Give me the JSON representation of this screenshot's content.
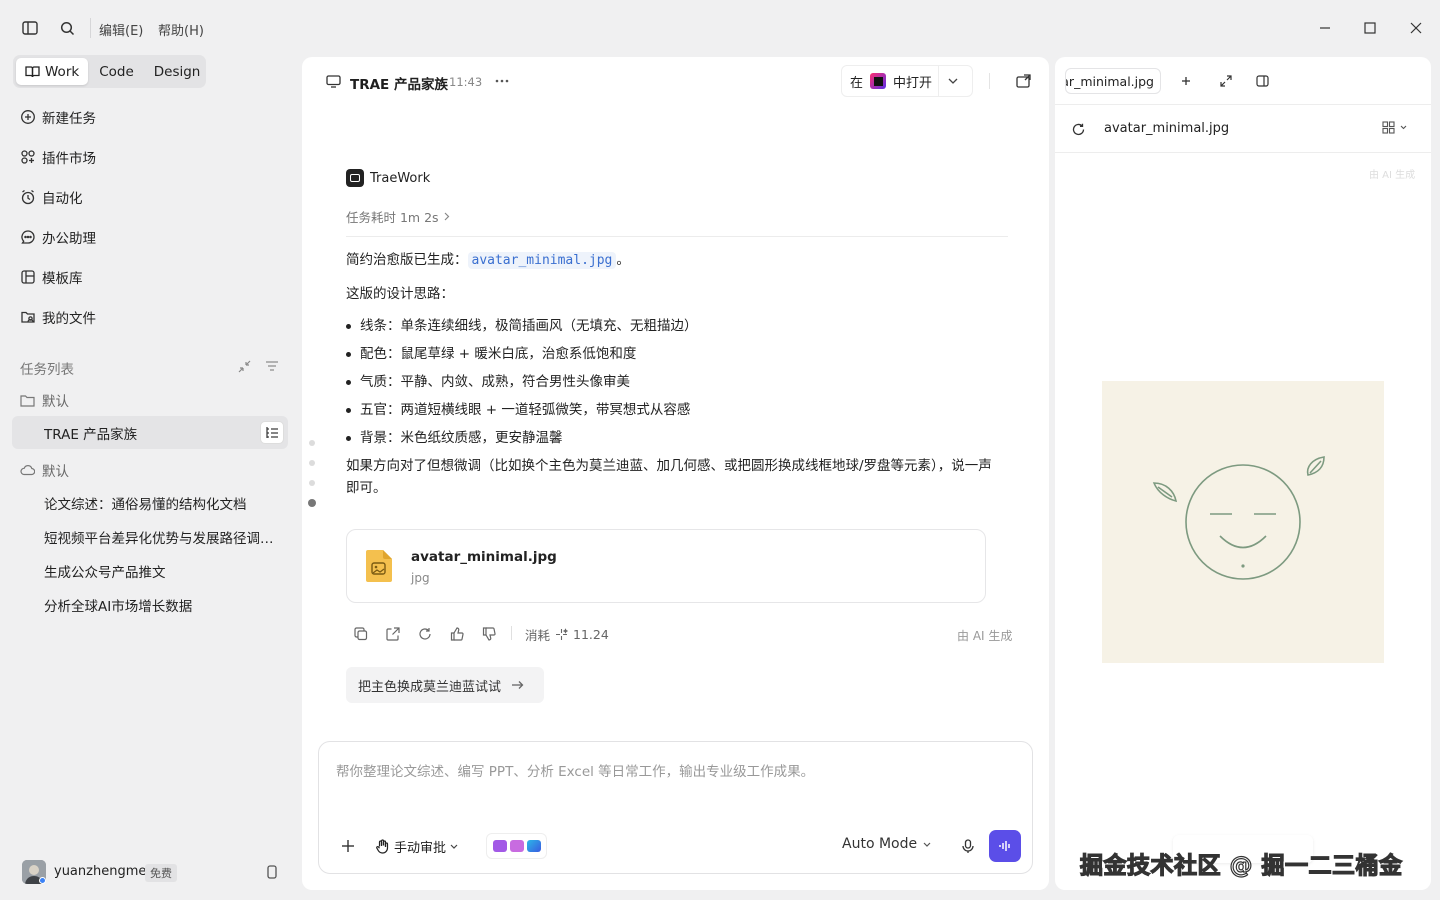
{
  "titlebar": {
    "menu_edit": "编辑(E)",
    "menu_help": "帮助(H)"
  },
  "mode_tabs": [
    {
      "label": "Work",
      "active": true
    },
    {
      "label": "Code",
      "active": false
    },
    {
      "label": "Design",
      "active": false
    }
  ],
  "nav": [
    {
      "label": "新建任务",
      "icon": "new-task-icon"
    },
    {
      "label": "插件市场",
      "icon": "plugin-market-icon"
    },
    {
      "label": "自动化",
      "icon": "automation-icon"
    },
    {
      "label": "办公助理",
      "icon": "office-assistant-icon"
    },
    {
      "label": "模板库",
      "icon": "template-library-icon"
    },
    {
      "label": "我的文件",
      "icon": "my-files-icon"
    }
  ],
  "task_list": {
    "title": "任务列表",
    "group1": {
      "label": "默认",
      "tasks": [
        "TRAE 产品家族"
      ]
    },
    "group2": {
      "label": "默认",
      "tasks": [
        "论文综述：通俗易懂的结构化文档",
        "短视频平台差异化优势与发展路径调研报告",
        "生成公众号产品推文",
        "分析全球AI市场增长数据"
      ]
    }
  },
  "user": {
    "name": "yuanzhengme",
    "plan": "免费"
  },
  "chat": {
    "title": "TRAE 产品家族",
    "time": "11:43",
    "open_in": {
      "prefix": "在",
      "label": "中打开"
    },
    "agent": "TraeWork",
    "duration": "任务耗时 1m 2s",
    "msg_intro_prefix": "简约治愈版已生成：",
    "msg_intro_file": "avatar_minimal.jpg",
    "msg_intro_suffix": "。",
    "msg_design_title": "这版的设计思路：",
    "bullets": [
      "线条：单条连续细线，极简插画风（无填充、无粗描边）",
      "配色：鼠尾草绿 + 暖米白底，治愈系低饱和度",
      "气质：平静、内敛、成熟，符合男性头像审美",
      "五官：两道短横线眼 + 一道轻弧微笑，带冥想式从容感",
      "背景：米色纸纹质感，更安静温馨"
    ],
    "msg_followup": "如果方向对了但想微调（比如换个主色为莫兰迪蓝、加几何感、或把圆形换成线框地球/罗盘等元素），说一声即可。",
    "file_card": {
      "name": "avatar_minimal.jpg",
      "type": "jpg"
    },
    "consume_label": "消耗",
    "consume_value": "11.24",
    "ai_generated": "由 AI 生成",
    "suggestion": "把主色换成莫兰迪蓝试试",
    "composer": {
      "placeholder": "帮你整理论文综述、编写 PPT、分析 Excel 等日常工作，输出专业级工作成果。",
      "approval": "手动审批",
      "mode": "Auto Mode"
    }
  },
  "preview": {
    "tab_label": "tar_minimal.jpg",
    "file_name": "avatar_minimal.jpg",
    "ai_tag": "由 AI 生成"
  },
  "watermark": "掘金技术社区 @ 掘一二三桶金",
  "colors": {
    "accent": "#5b4ee8",
    "link": "#3a6fd0",
    "sage": "#7d9a80",
    "paper": "#f6f2e6"
  }
}
